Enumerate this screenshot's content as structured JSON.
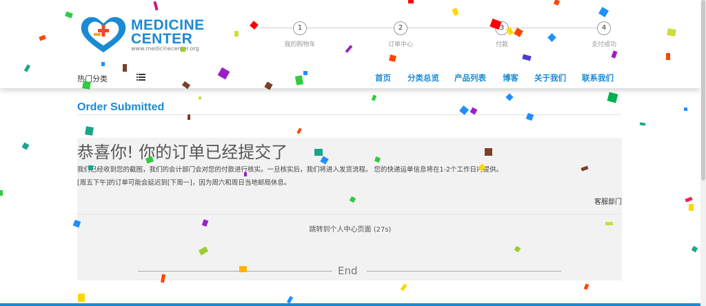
{
  "brand": {
    "line1": "MEDICINE",
    "line2": "CENTER",
    "url": "www.medicinecenter.org",
    "color": "#1a8ad4"
  },
  "steps": [
    {
      "num": "1",
      "label": "我的购物车"
    },
    {
      "num": "2",
      "label": "订单中心"
    },
    {
      "num": "3",
      "label": "付款"
    },
    {
      "num": "4",
      "label": "支付成功"
    }
  ],
  "nav": {
    "hot_categories": "热门分类",
    "items": [
      "首页",
      "分类总览",
      "产品列表",
      "博客",
      "关于我们",
      "联系我们"
    ]
  },
  "page_title": "Order Submitted",
  "confirmation": {
    "heading": "恭喜你! 你的订单已经提交了",
    "para1": "我们已经收到您的截图，我们的会计部门会对您的付款进行核实。一旦核实后，我们将进入发货流程。 您的快递运单信息将在1-2个工作日内提供。",
    "para2": "[周五下午]的订单可能会延迟到[下周一]，因为周六和周日当地邮局休息。",
    "department": "客服部门",
    "redirect": "跳转到个人中心页面 (27s)",
    "end": "End"
  }
}
